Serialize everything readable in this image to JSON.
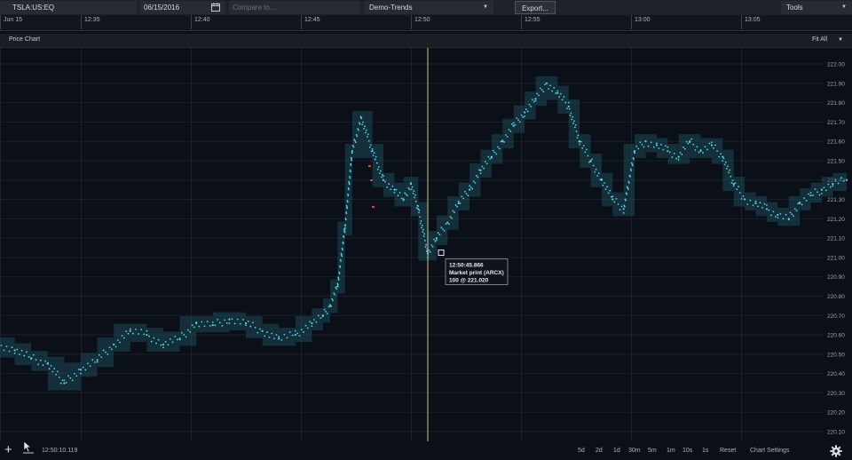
{
  "toolbar": {
    "symbol": "TSLA:US:EQ",
    "date": "06/15/2016",
    "compare_placeholder": "Compare to...",
    "dataset": "Demo-Trends",
    "export_label": "Export...",
    "tools_label": "Tools"
  },
  "timebar": {
    "ticks": [
      "Jun 15",
      "12:35",
      "12:40",
      "12:45",
      "12:50",
      "12:55",
      "13:00",
      "13:05"
    ]
  },
  "panel": {
    "title": "Price Chart",
    "fit_label": "Fit All"
  },
  "chart_data": {
    "type": "scatter",
    "y_ticks": [
      "222.00",
      "221.90",
      "221.80",
      "221.70",
      "221.60",
      "221.50",
      "221.40",
      "221.30",
      "221.20",
      "221.10",
      "221.00",
      "220.90",
      "220.80",
      "220.70",
      "220.60",
      "220.50",
      "220.40",
      "220.30",
      "220.20",
      "220.10"
    ],
    "ylim": [
      220.05,
      222.05
    ],
    "x_ticks": [
      "Jun 15",
      "12:35",
      "12:40",
      "12:45",
      "12:50",
      "12:55",
      "13:00",
      "13:05"
    ],
    "xlim": [
      "12:31:16",
      "13:09:48"
    ],
    "series": [
      {
        "x": [
          "12:31:16",
          "12:32:00",
          "12:32:45",
          "12:33:30",
          "12:34:15",
          "12:35:00",
          "12:35:45",
          "12:36:30",
          "12:37:15",
          "12:38:00",
          "12:38:45",
          "12:39:30",
          "12:40:15",
          "12:41:00",
          "12:41:45",
          "12:42:30",
          "12:43:15",
          "12:44:00",
          "12:44:45",
          "12:45:30",
          "12:46:00",
          "12:46:20",
          "12:46:40",
          "12:47:00",
          "12:47:20",
          "12:47:45",
          "12:48:15",
          "12:48:45",
          "12:49:15",
          "12:49:40",
          "12:50:00",
          "12:50:20",
          "12:50:46",
          "12:51:10",
          "12:51:40",
          "12:52:10",
          "12:52:40",
          "12:53:10",
          "12:53:40",
          "12:54:10",
          "12:54:40",
          "12:55:10",
          "12:55:40",
          "12:56:10",
          "12:56:40",
          "12:57:10",
          "12:57:40",
          "12:58:10",
          "12:58:40",
          "12:59:10",
          "12:59:40",
          "13:00:10",
          "13:00:40",
          "13:01:10",
          "13:01:40",
          "13:02:10",
          "13:02:40",
          "13:03:10",
          "13:03:40",
          "13:04:10",
          "13:04:40",
          "13:05:10",
          "13:05:40",
          "13:06:10",
          "13:06:40",
          "13:07:10",
          "13:07:40",
          "13:08:10",
          "13:08:40",
          "13:09:10",
          "13:09:48"
        ],
        "y": [
          220.55,
          220.52,
          220.48,
          220.45,
          220.35,
          220.42,
          220.47,
          220.55,
          220.62,
          220.6,
          220.55,
          220.58,
          220.66,
          220.65,
          220.68,
          220.66,
          220.62,
          220.58,
          220.6,
          220.66,
          220.7,
          220.75,
          220.85,
          221.15,
          221.55,
          221.72,
          221.55,
          221.4,
          221.35,
          221.3,
          221.38,
          221.25,
          221.02,
          221.1,
          221.18,
          221.28,
          221.35,
          221.45,
          221.52,
          221.6,
          221.68,
          221.75,
          221.82,
          221.9,
          221.85,
          221.78,
          221.6,
          221.5,
          221.4,
          221.3,
          221.25,
          221.55,
          221.6,
          221.58,
          221.55,
          221.52,
          221.6,
          221.55,
          221.58,
          221.52,
          221.38,
          221.3,
          221.28,
          221.25,
          221.22,
          221.2,
          221.28,
          221.32,
          221.35,
          221.38,
          221.4
        ]
      }
    ],
    "cursor_time": "12:50:46",
    "tooltip": {
      "time": "12:50:45.866",
      "label": "Market print (ARCX)",
      "value": "100 @ 221.020"
    },
    "colors": {
      "points": "#4fd6e6",
      "band": "#1d4a55",
      "cursor_line": "#cdc58a",
      "alert": "#d9473f"
    }
  },
  "bottombar": {
    "clock": "12:50:10.119",
    "timeframes": [
      "5d",
      "2d",
      "1d",
      "30m",
      "5m",
      "1m",
      "10s",
      "1s",
      "Reset",
      "Chart Settings"
    ]
  }
}
